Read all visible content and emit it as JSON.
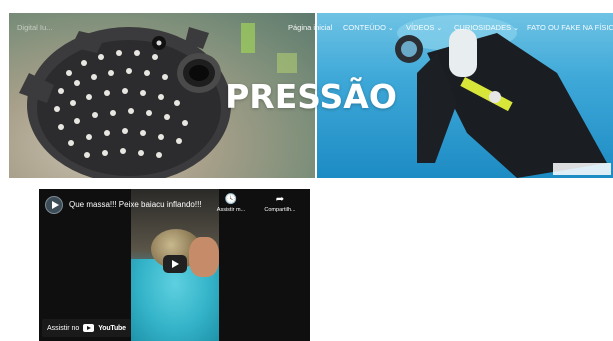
{
  "hero": {
    "logo": "Digital Iu...",
    "title": "PRESSÃO",
    "nav": [
      {
        "label": "Página inicial",
        "dropdown": false
      },
      {
        "label": "CONTEÚDO",
        "dropdown": true
      },
      {
        "label": "VÍDEOS",
        "dropdown": true
      },
      {
        "label": "CURIOSIDADES",
        "dropdown": true
      },
      {
        "label": "FATO OU FAKE NA FÍSICA",
        "dropdown": true
      }
    ]
  },
  "video": {
    "title": "Que massa!!! Peixe baiacu inflando!!!",
    "actions": [
      {
        "icon": "clock-icon",
        "label": "Assistir m..."
      },
      {
        "icon": "share-icon",
        "label": "Compartilh..."
      }
    ],
    "watch_on": "Assistir no",
    "platform": "YouTube"
  }
}
